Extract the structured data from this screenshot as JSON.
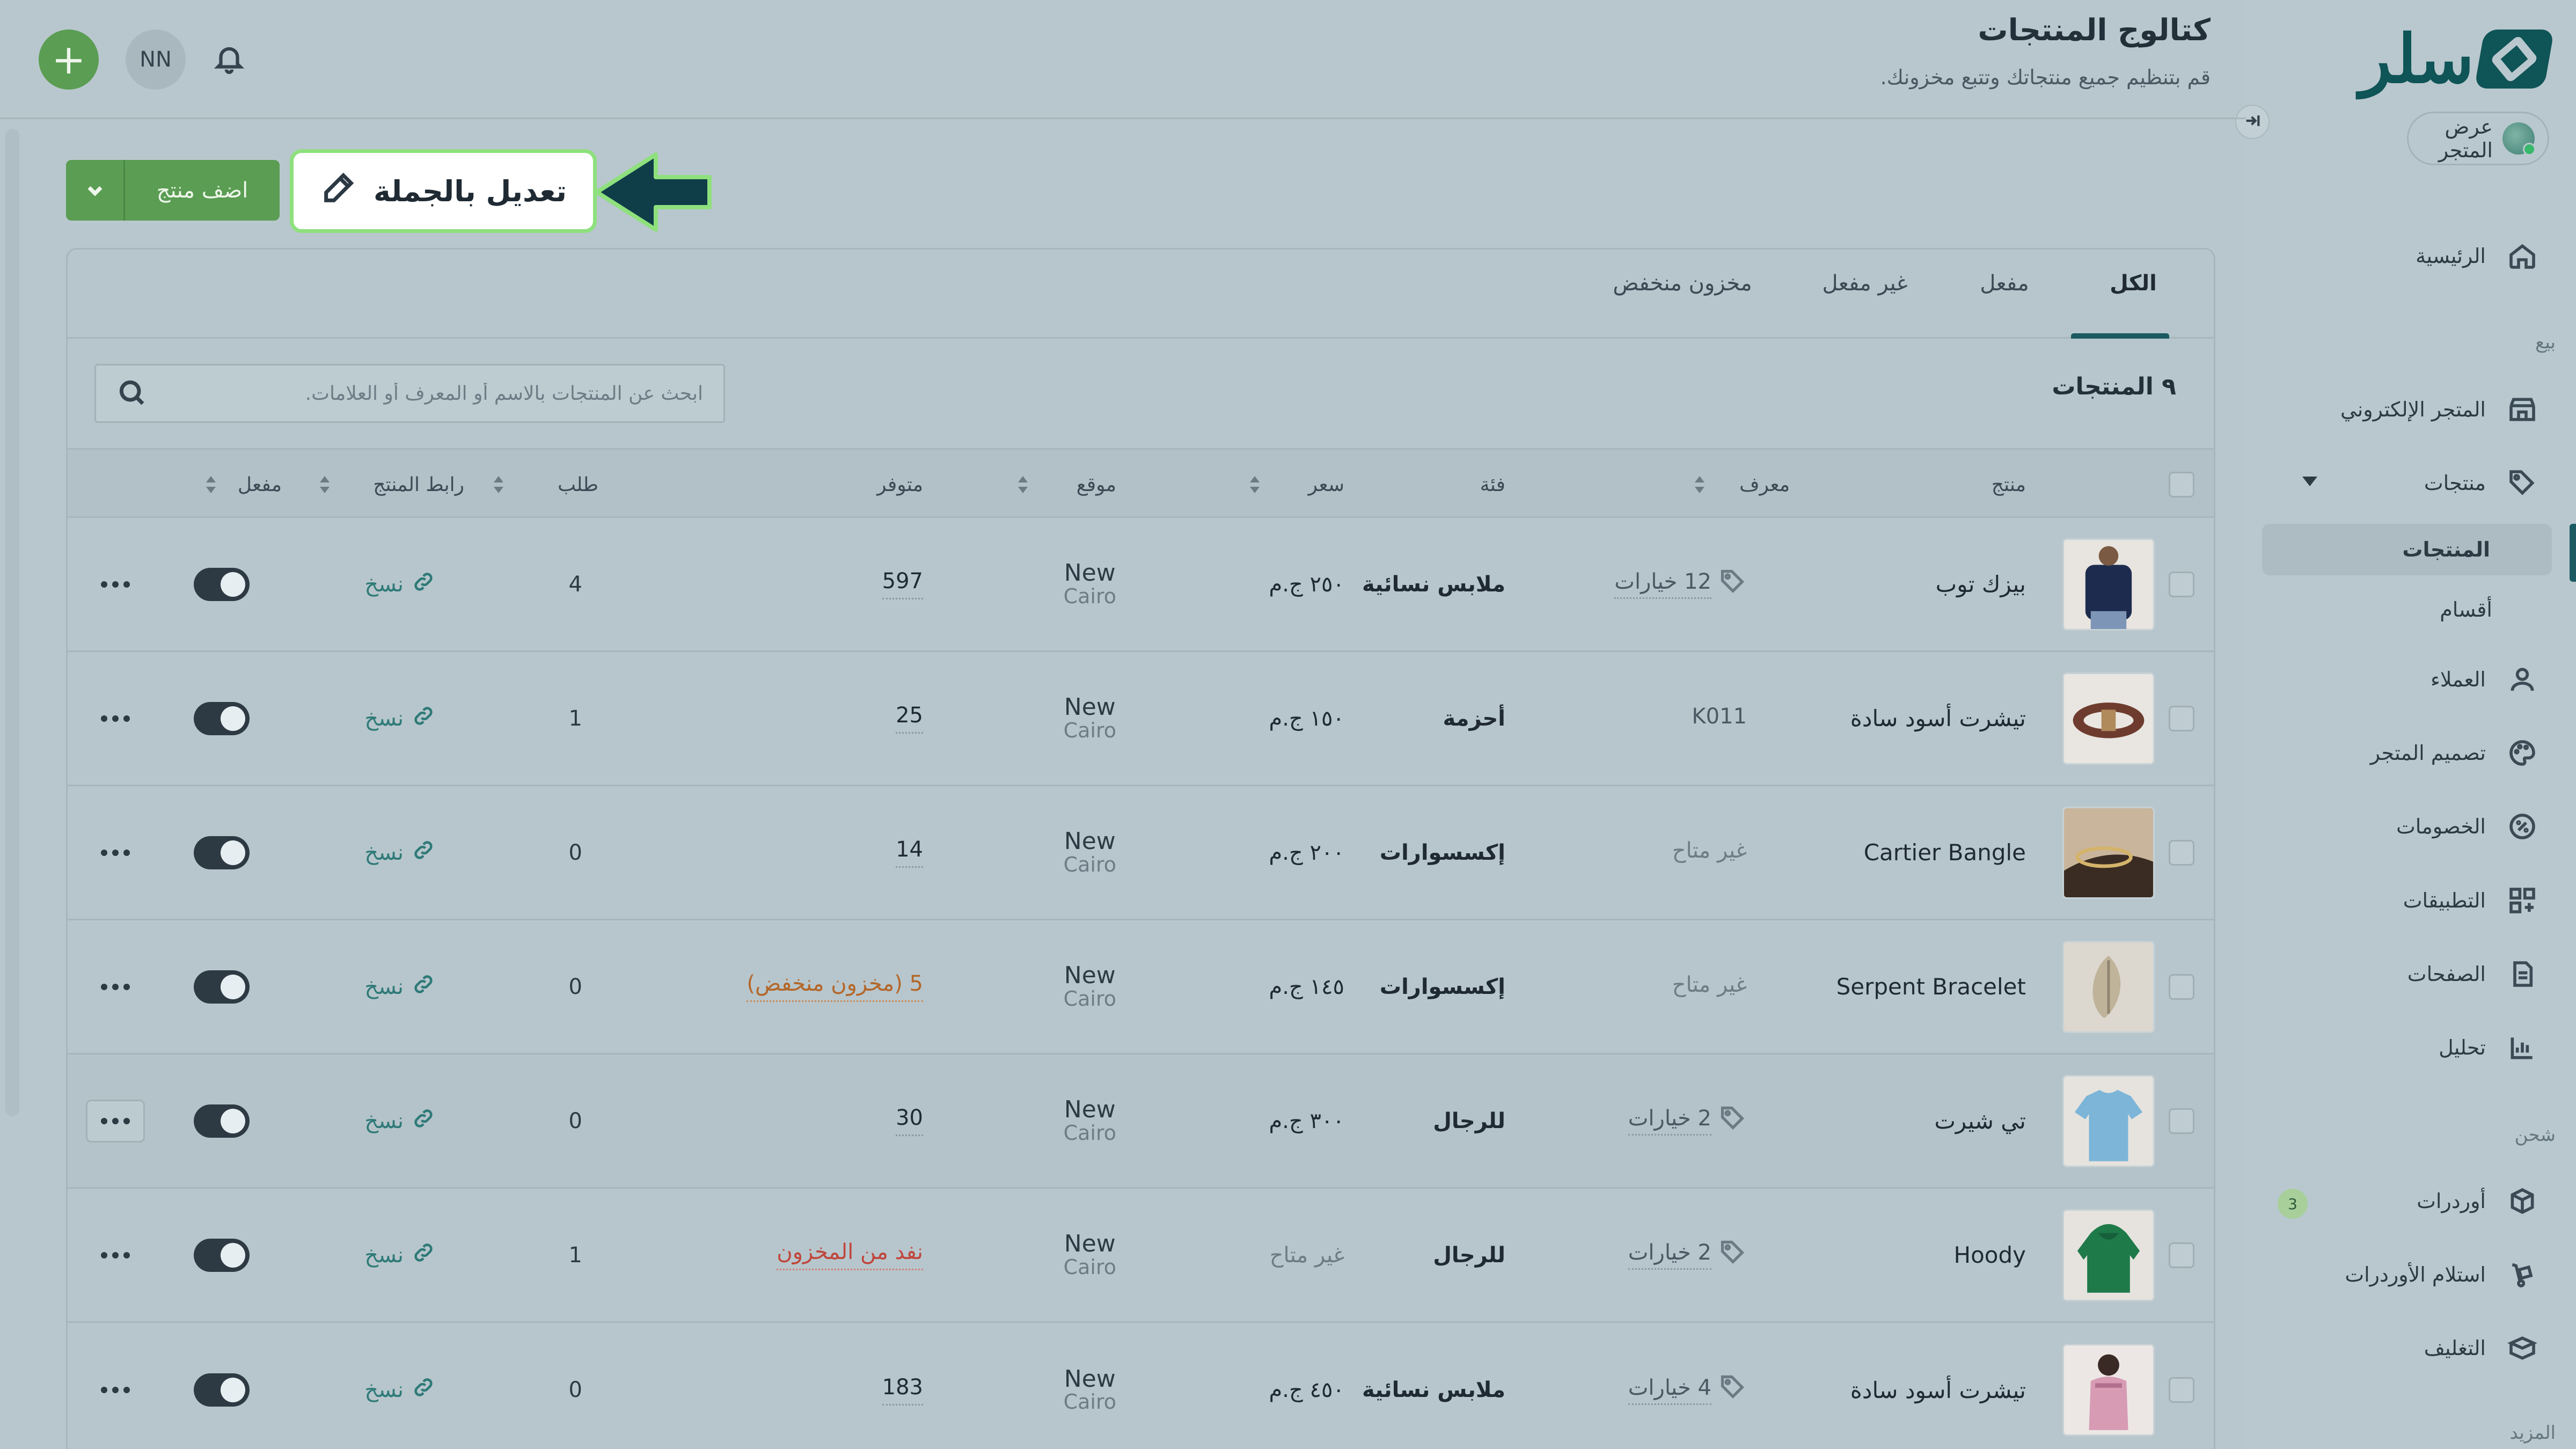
{
  "brand": {
    "logo_text": "سلر"
  },
  "sidebar": {
    "view_store": "عرض المتجر",
    "home": "الرئيسية",
    "section_sell": "بيع",
    "online_store": "المتجر الإلكتروني",
    "products": "منتجات",
    "products_sub": "المنتجات",
    "categories": "أقسام",
    "customers": "العملاء",
    "store_design": "تصميم المتجر",
    "discounts": "الخصومات",
    "apps": "التطبيقات",
    "pages": "الصفحات",
    "analytics": "تحليل",
    "section_shipping": "شحن",
    "orders": "أوردرات",
    "orders_badge": "3",
    "receive_orders": "استلام الأوردرات",
    "packaging": "التغليف",
    "section_more": "المزيد"
  },
  "header": {
    "title": "كتالوج المنتجات",
    "subtitle": "قم بتنظيم جميع منتجاتك وتتبع مخزونك.",
    "avatar_initials": "NN",
    "add_symbol": "+"
  },
  "toolbar": {
    "add_product": "اضف منتج",
    "bulk_edit": "تعديل بالجملة"
  },
  "tabs": [
    "الكل",
    "مفعل",
    "غير مفعل",
    "مخزون منخفض"
  ],
  "products_count": "٩ المنتجات",
  "search": {
    "placeholder": "ابحث عن المنتجات بالاسم أو المعرف أو العلامات."
  },
  "columns": {
    "product": "منتج",
    "sku": "معرف",
    "category": "فئة",
    "price": "سعر",
    "location": "موقع",
    "available": "متوفر",
    "orders": "طلب",
    "link": "رابط المنتج",
    "enabled": "مفعل"
  },
  "rows": [
    {
      "name": "بيزك توب",
      "sku": "12 خيارات",
      "category": "ملابس نسائية",
      "price": "٢٥٠ ج.م",
      "loc1": "New",
      "loc2": "Cairo",
      "available": "597",
      "orders": "4",
      "link": "نسخ"
    },
    {
      "name": "تيشرت أسود سادة",
      "sku": "K011",
      "category": "أحزمة",
      "price": "١٥٠ ج.م",
      "loc1": "New",
      "loc2": "Cairo",
      "available": "25",
      "orders": "1",
      "link": "نسخ"
    },
    {
      "name": "Cartier Bangle",
      "sku": "غير متاح",
      "category": "إكسسوارات",
      "price": "٢٠٠ ج.م",
      "loc1": "New",
      "loc2": "Cairo",
      "available": "14",
      "orders": "0",
      "link": "نسخ"
    },
    {
      "name": "Serpent Bracelet",
      "sku": "غير متاح",
      "category": "إكسسوارات",
      "price": "١٤٥ ج.م",
      "loc1": "New",
      "loc2": "Cairo",
      "available": "5 (مخزون منخفض)",
      "orders": "0",
      "link": "نسخ"
    },
    {
      "name": "تي شيرت",
      "sku": "2 خيارات",
      "category": "للرجال",
      "price": "٣٠٠ ج.م",
      "loc1": "New",
      "loc2": "Cairo",
      "available": "30",
      "orders": "0",
      "link": "نسخ"
    },
    {
      "name": "Hoody",
      "sku": "2 خيارات",
      "category": "للرجال",
      "price": "غير متاح",
      "loc1": "New",
      "loc2": "Cairo",
      "available": "نفد من المخزون",
      "orders": "1",
      "link": "نسخ"
    },
    {
      "name": "تيشرت أسود سادة",
      "sku": "4 خيارات",
      "category": "ملابس نسائية",
      "price": "٤٥٠ ج.م",
      "loc1": "New",
      "loc2": "Cairo",
      "available": "183",
      "orders": "0",
      "link": "نسخ"
    }
  ]
}
